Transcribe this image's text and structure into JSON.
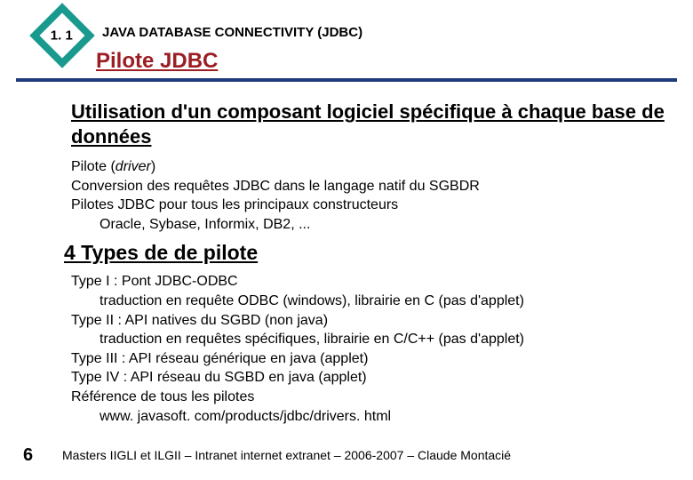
{
  "header": {
    "section_number": "1. 1",
    "chapter_title": "JAVA DATABASE CONNECTIVITY (JDBC)",
    "slide_title": "Pilote JDBC"
  },
  "content": {
    "heading_a": "Utilisation d'un composant logiciel spécifique à chaque base de données",
    "block_a": {
      "l1_pre": "Pilote (",
      "l1_it": "driver",
      "l1_post": ")",
      "l2": "Conversion des requêtes JDBC dans le langage natif du SGBDR",
      "l3": "Pilotes JDBC pour tous les principaux constructeurs",
      "l4": "Oracle, Sybase, Informix, DB2, ..."
    },
    "heading_b": "4 Types de de pilote",
    "block_b": {
      "l1": "Type I : Pont JDBC-ODBC",
      "l2": "traduction en requête ODBC (windows), librairie en C (pas d'applet)",
      "l3": "Type II : API natives du SGBD (non java)",
      "l4": "traduction en requêtes spécifiques, librairie en C/C++ (pas d'applet)",
      "l5": "Type III : API réseau générique en java (applet)",
      "l6": "Type IV : API réseau du SGBD en java (applet)",
      "l7": "Référence de tous les pilotes",
      "l8": "www. javasoft. com/products/jdbc/drivers. html"
    }
  },
  "footer": {
    "page": "6",
    "text": "Masters IIGLI et ILGII – Intranet internet extranet – 2006-2007 – Claude Montacié"
  }
}
